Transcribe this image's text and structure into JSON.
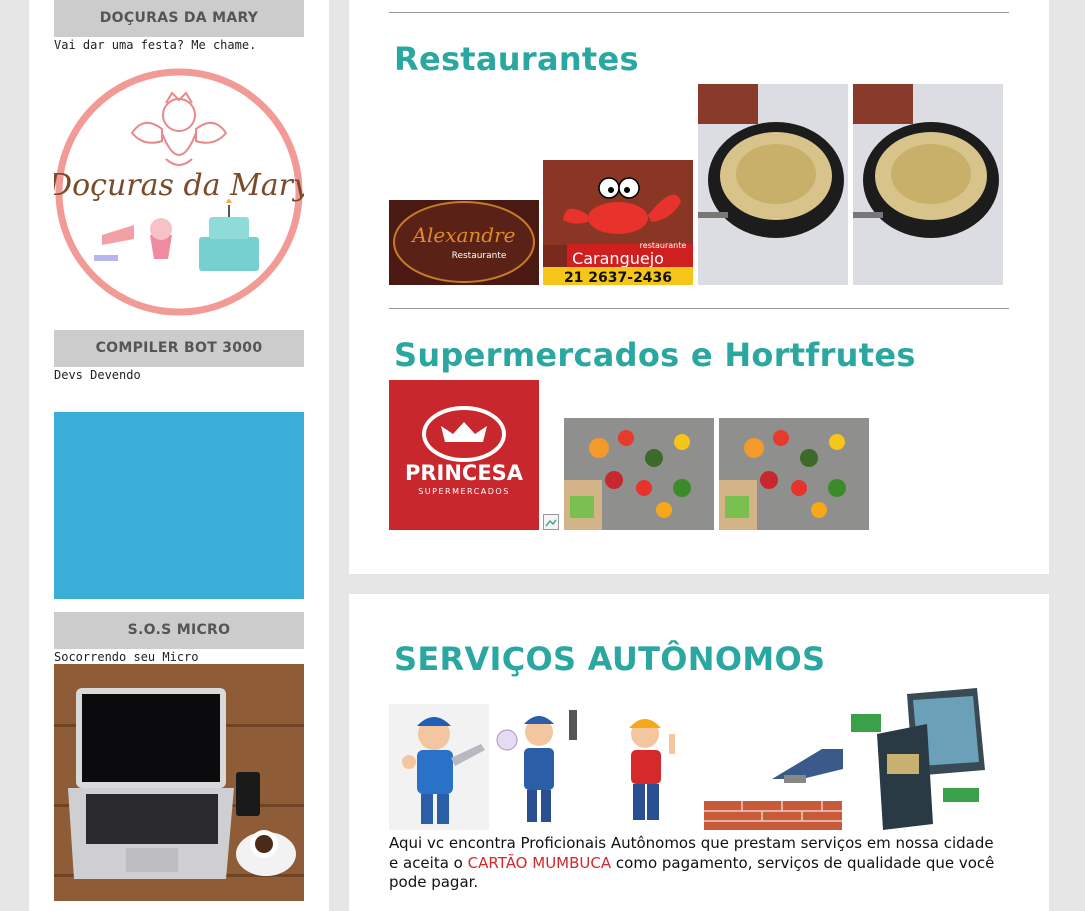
{
  "sidebar": {
    "widgets": [
      {
        "title": "DOÇURAS DA MARY",
        "desc": "Vai dar uma festa? Me chame.",
        "logo_text": "Doçuras da Mary"
      },
      {
        "title": "COMPILER BOT 3000",
        "desc": "Devs Devendo"
      },
      {
        "title": "S.O.S MICRO",
        "desc": "Socorrendo seu Micro"
      }
    ]
  },
  "restaurants": {
    "heading": "Restaurantes",
    "alexandre_name": "Alexandre",
    "alexandre_sub": "Restaurante",
    "caranguejo_tag": "restaurante",
    "caranguejo_name": "Caranguejo",
    "caranguejo_phone": "21 2637-2436"
  },
  "supermarkets": {
    "heading": "Supermercados e Hortfrutes",
    "princesa_name": "PRINCESA",
    "princesa_sub": "SUPERMERCADOS"
  },
  "services": {
    "heading": "SERVIÇOS AUTÔNOMOS",
    "text_before": "Aqui vc encontra Proficionais Autônomos que prestam serviços em nossa cidade e aceita o ",
    "text_highlight": "CARTÃO MUMBUCA",
    "text_after": " como pagamento, serviços de qualidade que você pode pagar."
  },
  "colors": {
    "accent": "#2aa7a0",
    "highlight": "#d4282b",
    "blue_block": "#3aaed6"
  }
}
